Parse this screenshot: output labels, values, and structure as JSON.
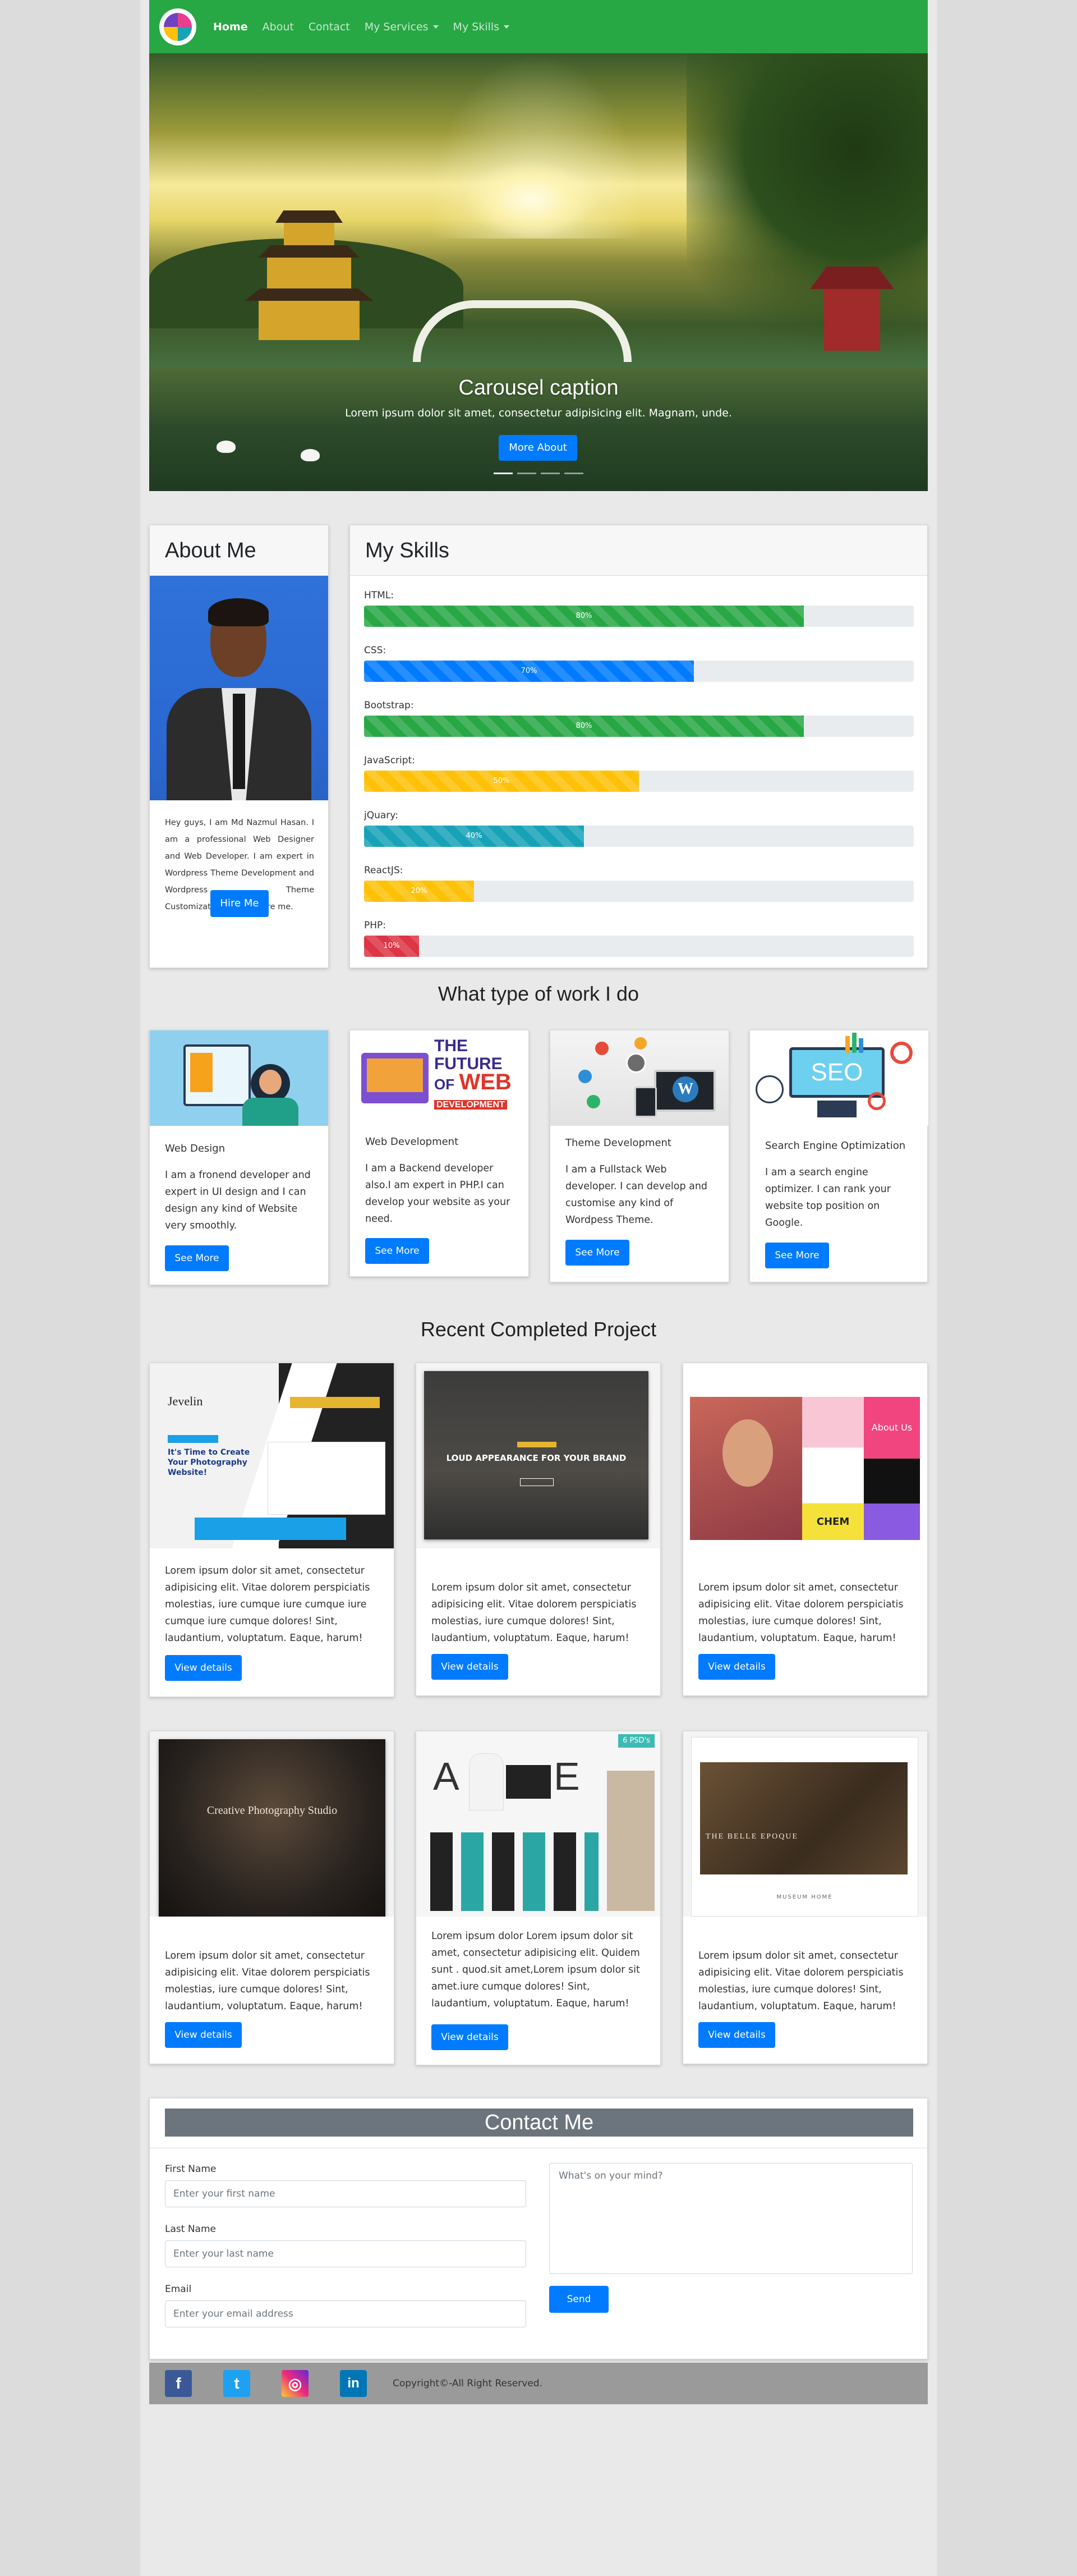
{
  "nav": {
    "brand": "logo",
    "items": [
      {
        "label": "Home",
        "active": true,
        "dropdown": false
      },
      {
        "label": "About",
        "active": false,
        "dropdown": false
      },
      {
        "label": "Contact",
        "active": false,
        "dropdown": false
      },
      {
        "label": "My Services",
        "active": false,
        "dropdown": true
      },
      {
        "label": "My Skills",
        "active": false,
        "dropdown": true
      }
    ]
  },
  "carousel": {
    "caption_title": "Carousel caption",
    "caption_text": "Lorem ipsum dolor sit amet, consectetur adipisicing elit. Magnam, unde.",
    "button": "More About",
    "slides": 4,
    "active_slide": 1
  },
  "about": {
    "title": "About Me",
    "text": "Hey guys, I am Md Nazmul Hasan. I am a professional Web Designer and Web Developer. I am expert in Wordpress Theme Development and Wordpress Theme Customization.You can hire me.",
    "button": "Hire Me"
  },
  "skills": {
    "title": "My Skills",
    "items": [
      {
        "label": "HTML:",
        "percent": 80,
        "text": "80%",
        "color": "#28a745"
      },
      {
        "label": "CSS:",
        "percent": 60,
        "text": "70%",
        "color": "#007bff"
      },
      {
        "label": "Bootstrap:",
        "percent": 80,
        "text": "80%",
        "color": "#28a745"
      },
      {
        "label": "JavaScript:",
        "percent": 50,
        "text": "50%",
        "color": "#ffc107"
      },
      {
        "label": "jQuary:",
        "percent": 40,
        "text": "40%",
        "color": "#17a2b8"
      },
      {
        "label": "ReactJS:",
        "percent": 20,
        "text": "20%",
        "color": "#ffc107"
      },
      {
        "label": "PHP:",
        "percent": 10,
        "text": "10%",
        "color": "#dc3545"
      }
    ]
  },
  "services": {
    "title": "What type of work I do",
    "items": [
      {
        "title": "Web Design",
        "text": "I am a fronend developer and expert in UI design and I can design any kind of Website very smoothly.",
        "button": "See More"
      },
      {
        "title": "Web Development",
        "text": "I am a Backend developer also.I am expert in PHP.I can develop your website as your need.",
        "button": "See More",
        "image_text": [
          "THE",
          "FUTURE",
          "OF",
          "WEB",
          "DEVELOPMENT"
        ]
      },
      {
        "title": "Theme Development",
        "text": "I am a Fullstack Web developer. I can develop and customise any kind of Wordpess Theme.",
        "button": "See More"
      },
      {
        "title": "Search Engine Optimization",
        "text": "I am a search engine optimizer. I can rank your website top position on Google.",
        "button": "See More",
        "image_text": [
          "SEO"
        ]
      }
    ]
  },
  "projects": {
    "title": "Recent Completed Project",
    "items": [
      {
        "text": "Lorem ipsum dolor sit amet, consectetur adipisicing elit. Vitae dolorem perspiciatis molestias, iure cumque iure cumque iure cumque iure cumque dolores! Sint, laudantium, voluptatum. Eaque, harum!",
        "button": "View details",
        "image_text": [
          "Jevelin",
          "It's Time to Create Your Photography Website!"
        ]
      },
      {
        "text": "Lorem ipsum dolor sit amet, consectetur adipisicing elit. Vitae dolorem perspiciatis molestias, iure cumque dolores! Sint, laudantium, voluptatum. Eaque, harum!",
        "button": "View details",
        "image_text": [
          "LOUD APPEARANCE FOR YOUR BRAND"
        ]
      },
      {
        "text": "Lorem ipsum dolor sit amet, consectetur adipisicing elit. Vitae dolorem perspiciatis molestias, iure cumque dolores! Sint, laudantium, voluptatum. Eaque, harum!",
        "button": "View details",
        "image_text": [
          "About Us",
          "CHEM"
        ]
      },
      {
        "text": "Lorem ipsum dolor sit amet, consectetur adipisicing elit. Vitae dolorem perspiciatis molestias, iure cumque dolores! Sint, laudantium, voluptatum. Eaque, harum!",
        "button": "View details",
        "image_text": [
          "Creative Photography Studio"
        ]
      },
      {
        "text": "Lorem ipsum dolor Lorem ipsum dolor sit amet, consectetur adipisicing elit. Quidem sunt . quod.sit amet,Lorem ipsum dolor sit amet.iure cumque dolores! Sint, laudantium, voluptatum. Eaque, harum!",
        "button": "View details",
        "image_text": [
          "A",
          "E",
          "6 PSD's"
        ]
      },
      {
        "text": "Lorem ipsum dolor sit amet, consectetur adipisicing elit. Vitae dolorem perspiciatis molestias, iure cumque dolores! Sint, laudantium, voluptatum. Eaque, harum!",
        "button": "View details",
        "image_text": [
          "THE BELLE EPOQUE",
          "MUSEUM HOME"
        ]
      }
    ]
  },
  "contact": {
    "title": "Contact Me",
    "first_name_label": "First Name",
    "first_name_placeholder": "Enter your first name",
    "last_name_label": "Last Name",
    "last_name_placeholder": "Enter your last name",
    "email_label": "Email",
    "email_placeholder": "Enter your email address",
    "message_placeholder": "What's on your mind?",
    "send": "Send"
  },
  "footer": {
    "social": [
      {
        "name": "facebook-icon",
        "glyph": "f",
        "color": "#3b5998"
      },
      {
        "name": "twitter-icon",
        "glyph": "t",
        "color": "#1da1f2"
      },
      {
        "name": "instagram-icon",
        "glyph": "◎",
        "color": "#d6249f"
      },
      {
        "name": "linkedin-icon",
        "glyph": "in",
        "color": "#0077b5"
      }
    ],
    "copyright": "Copyright©-All Right Reserved."
  }
}
